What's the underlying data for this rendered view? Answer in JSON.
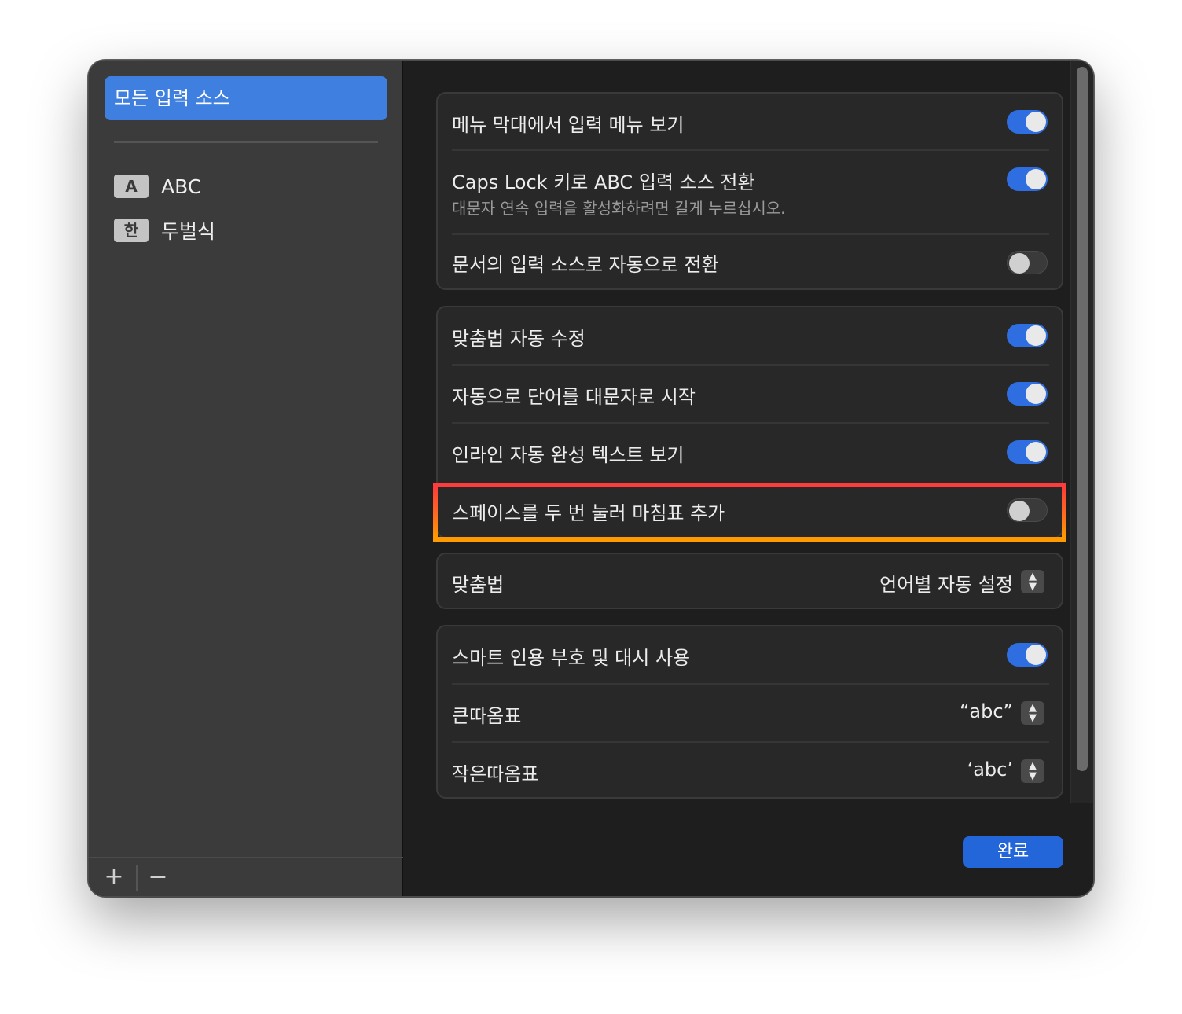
{
  "sidebar": {
    "selected_label": "모든 입력 소스",
    "sources": [
      {
        "badge": "A",
        "label": "ABC"
      },
      {
        "badge": "한",
        "label": "두벌식"
      }
    ],
    "add_label": "+",
    "remove_label": "−"
  },
  "groups": {
    "menu": {
      "show_input_menu": {
        "label": "메뉴 막대에서 입력 메뉴 보기",
        "enabled": true
      },
      "caps_lock": {
        "label": "Caps Lock 키로 ABC 입력 소스 전환",
        "sublabel": "대문자 연속 입력을 활성화하려면 길게 누르십시오.",
        "enabled": true
      },
      "auto_switch": {
        "label": "문서의 입력 소스로 자동으로 전환",
        "enabled": false
      }
    },
    "typing": {
      "autocorrect": {
        "label": "맞춤법 자동 수정",
        "enabled": true
      },
      "capitalize": {
        "label": "자동으로 단어를 대문자로 시작",
        "enabled": true
      },
      "inline_predict": {
        "label": "인라인 자동 완성 텍스트 보기",
        "enabled": true
      },
      "double_space_period": {
        "label": "스페이스를 두 번 눌러 마침표 추가",
        "enabled": false
      }
    },
    "spelling": {
      "label": "맞춤법",
      "value": "언어별 자동 설정"
    },
    "quotes": {
      "smart_quotes": {
        "label": "스마트 인용 부호 및 대시 사용",
        "enabled": true
      },
      "double_quotes": {
        "label": "큰따옴표",
        "value": "“abc”"
      },
      "single_quotes": {
        "label": "작은따옴표",
        "value": "‘abc’"
      }
    }
  },
  "footer": {
    "done_label": "완료"
  },
  "colors": {
    "accent": "#2f6ee0",
    "highlight_top": "#ff3b3b",
    "highlight_bottom": "#ff9a00"
  }
}
